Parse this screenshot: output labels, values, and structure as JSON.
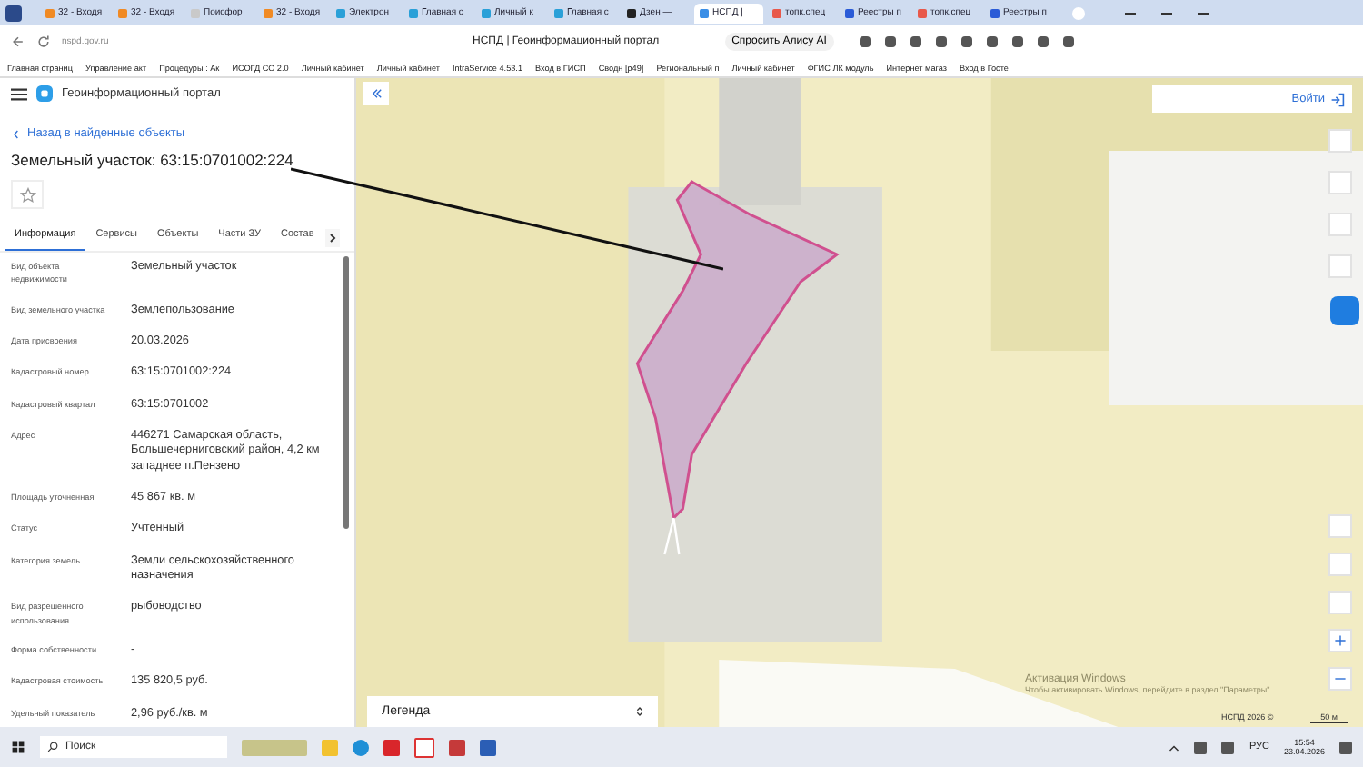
{
  "browser": {
    "tabs": [
      {
        "title": "32 - Входя",
        "selected": false,
        "color": "#f08a24"
      },
      {
        "title": "32 - Входя",
        "selected": false,
        "color": "#f08a24"
      },
      {
        "title": "Поисфор",
        "selected": false,
        "color": "#c9c9c9"
      },
      {
        "title": "32 - Входя",
        "selected": false,
        "color": "#f08a24"
      },
      {
        "title": "Электрон",
        "selected": false,
        "color": "#2aa0d8"
      },
      {
        "title": "Главная с",
        "selected": false,
        "color": "#2aa0d8"
      },
      {
        "title": "Личный к",
        "selected": false,
        "color": "#2aa0d8"
      },
      {
        "title": "Главная с",
        "selected": false,
        "color": "#2aa0d8"
      },
      {
        "title": "Дзен —",
        "selected": false,
        "color": "#222222"
      },
      {
        "title": "НСПД |",
        "selected": true,
        "color": "#3a8ee6"
      },
      {
        "title": "топк.спец",
        "selected": false,
        "color": "#e8584a"
      },
      {
        "title": "Реестры п",
        "selected": false,
        "color": "#2a5bd7"
      },
      {
        "title": "топк.спец",
        "selected": false,
        "color": "#e8584a"
      },
      {
        "title": "Реестры п",
        "selected": false,
        "color": "#2a5bd7"
      }
    ],
    "url": "nspd.gov.ru",
    "page_title": "НСПД | Геоинформационный портал",
    "alice_button": "Спросить Алису AI",
    "bookmarks": [
      "Главная страниц",
      "Управление акт",
      "Процедуры : Ак",
      "ИСОГД СО 2.0",
      "Личный кабинет",
      "Личный кабинет",
      "IntraService 4.53.1",
      "Вход в ГИСП",
      "Сводн [р49]",
      "Региональный п",
      "Личный кабинет",
      "ФГИС ЛК модуль",
      "Интернет магаз",
      "Вход в Госте"
    ]
  },
  "panel": {
    "portal_title": "Геоинформационный портал",
    "back_link": "Назад в найденные объекты",
    "object_title": "Земельный участок: 63:15:0701002:224",
    "tabs": [
      {
        "label": "Информация",
        "selected": true
      },
      {
        "label": "Сервисы",
        "selected": false
      },
      {
        "label": "Объекты",
        "selected": false
      },
      {
        "label": "Части ЗУ",
        "selected": false
      },
      {
        "label": "Состав",
        "selected": false
      }
    ],
    "fields": [
      {
        "label": "Вид объекта недвижимости",
        "value": "Земельный участок"
      },
      {
        "label": "Вид земельного участка",
        "value": "Землепользование"
      },
      {
        "label": "Дата присвоения",
        "value": "20.03.2026"
      },
      {
        "label": "Кадастровый номер",
        "value": "63:15:0701002:224"
      },
      {
        "label": "Кадастровый квартал",
        "value": "63:15:0701002"
      },
      {
        "label": "Адрес",
        "value": "446271 Самарская область, Большечерниговский район, 4,2 км западнее п.Пензено"
      },
      {
        "label": "Площадь уточненная",
        "value": "45 867 кв. м"
      },
      {
        "label": "Статус",
        "value": "Учтенный"
      },
      {
        "label": "Категория земель",
        "value": "Земли сельскохозяйственного назначения"
      },
      {
        "label": "Вид разрешенного использования",
        "value": "рыбоводство"
      },
      {
        "label": "Форма собственности",
        "value": "-"
      },
      {
        "label": "Кадастровая стоимость",
        "value": "135 820,5 руб."
      },
      {
        "label": "Удельный показатель",
        "value": "2,96 руб./кв. м"
      }
    ]
  },
  "map": {
    "login_button": "Войти",
    "legend_label": "Легенда",
    "attribution": "НСПД 2026 ©",
    "scale": "50 м",
    "activation_title": "Активация Windows",
    "activation_text": "Чтобы активировать Windows, перейдите в раздел \"Параметры\"."
  },
  "taskbar": {
    "search_placeholder": "Поиск",
    "language": "РУС",
    "time": "15:54",
    "date": "23.04.2026"
  }
}
